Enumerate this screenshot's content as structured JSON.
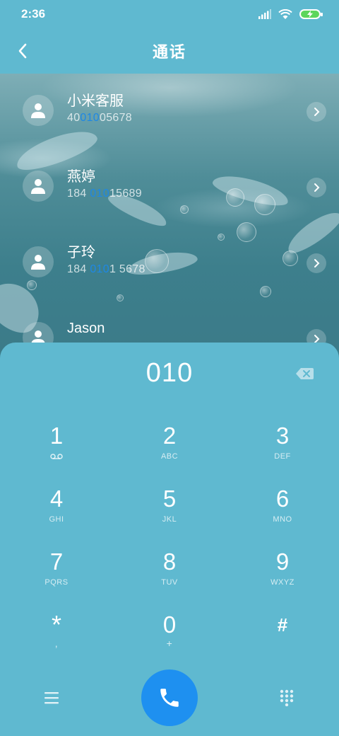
{
  "status": {
    "time": "2:36"
  },
  "header": {
    "title": "通话"
  },
  "contacts": [
    {
      "name": "小米客服",
      "num_pre": "40",
      "num_hl": "010",
      "num_post": "05678"
    },
    {
      "name": "燕婷",
      "num_pre": "184 ",
      "num_hl": "010",
      "num_post": "15689"
    },
    {
      "name": "子玲",
      "num_pre": "184 ",
      "num_hl": "010",
      "num_post": "1 5678"
    },
    {
      "name": "Jason",
      "num_pre": "",
      "num_hl": "",
      "num_post": ""
    }
  ],
  "dialer": {
    "entered": "010",
    "keys": [
      {
        "digit": "1",
        "letters": ""
      },
      {
        "digit": "2",
        "letters": "ABC"
      },
      {
        "digit": "3",
        "letters": "DEF"
      },
      {
        "digit": "4",
        "letters": "GHI"
      },
      {
        "digit": "5",
        "letters": "JKL"
      },
      {
        "digit": "6",
        "letters": "MNO"
      },
      {
        "digit": "7",
        "letters": "PQRS"
      },
      {
        "digit": "8",
        "letters": "TUV"
      },
      {
        "digit": "9",
        "letters": "WXYZ"
      },
      {
        "digit": "*",
        "letters": ","
      },
      {
        "digit": "0",
        "letters": "+"
      },
      {
        "digit": "#",
        "letters": ""
      }
    ]
  },
  "colors": {
    "background": "#5fb9d0",
    "call_button": "#1e90f0",
    "highlight": "#1e88e5"
  }
}
